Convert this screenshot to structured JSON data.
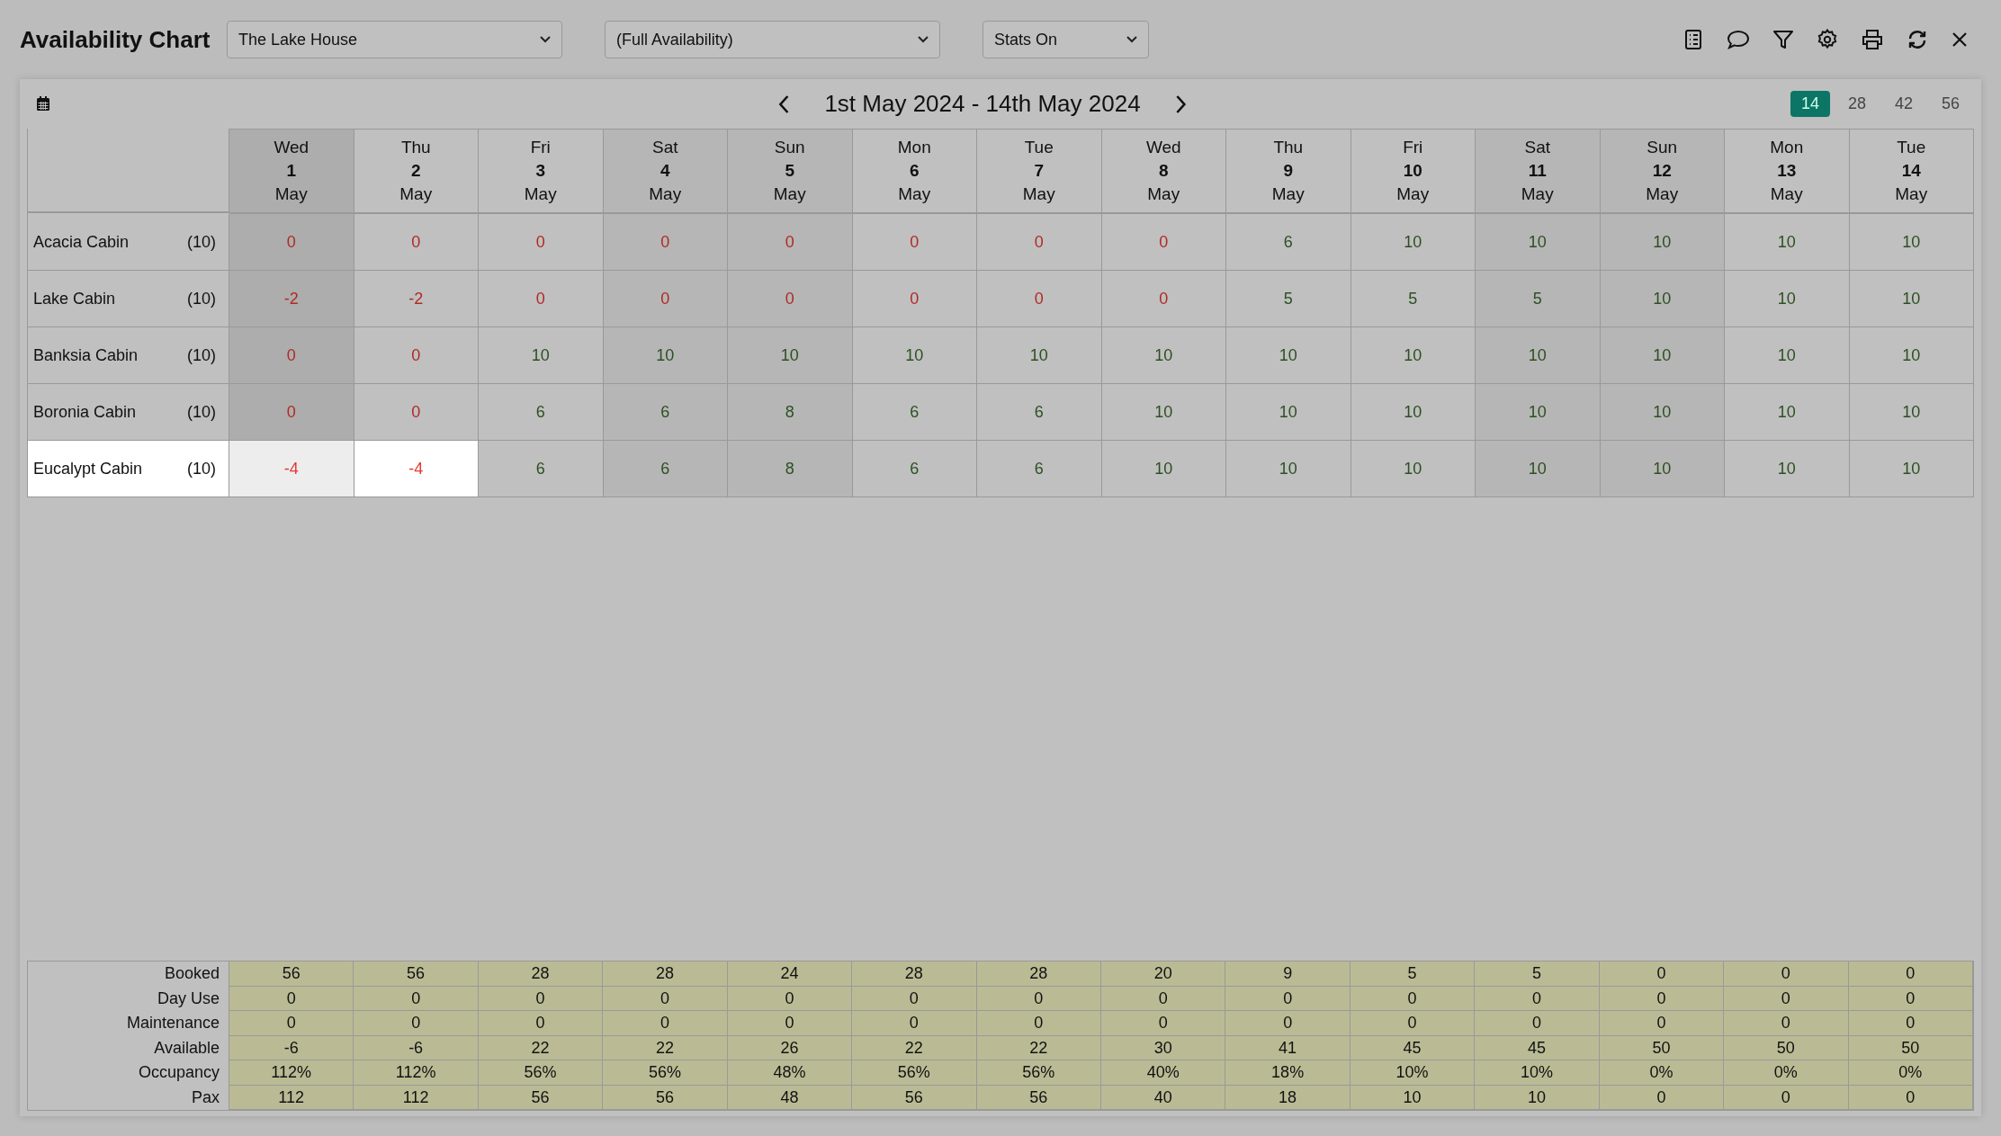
{
  "title": "Availability Chart",
  "property_select": {
    "value": "The Lake House"
  },
  "availability_select": {
    "value": "(Full Availability)"
  },
  "stats_select": {
    "value": "Stats On"
  },
  "date_range": "1st May 2024 - 14th May 2024",
  "range_options": [
    {
      "label": "14",
      "selected": true
    },
    {
      "label": "28",
      "selected": false
    },
    {
      "label": "42",
      "selected": false
    },
    {
      "label": "56",
      "selected": false
    }
  ],
  "days": [
    {
      "weekday": "Wed",
      "day": "1",
      "month": "May",
      "kind": "today"
    },
    {
      "weekday": "Thu",
      "day": "2",
      "month": "May",
      "kind": "weekday"
    },
    {
      "weekday": "Fri",
      "day": "3",
      "month": "May",
      "kind": "weekday"
    },
    {
      "weekday": "Sat",
      "day": "4",
      "month": "May",
      "kind": "weekend"
    },
    {
      "weekday": "Sun",
      "day": "5",
      "month": "May",
      "kind": "weekend"
    },
    {
      "weekday": "Mon",
      "day": "6",
      "month": "May",
      "kind": "weekday"
    },
    {
      "weekday": "Tue",
      "day": "7",
      "month": "May",
      "kind": "weekday"
    },
    {
      "weekday": "Wed",
      "day": "8",
      "month": "May",
      "kind": "weekday"
    },
    {
      "weekday": "Thu",
      "day": "9",
      "month": "May",
      "kind": "weekday"
    },
    {
      "weekday": "Fri",
      "day": "10",
      "month": "May",
      "kind": "weekday"
    },
    {
      "weekday": "Sat",
      "day": "11",
      "month": "May",
      "kind": "weekend"
    },
    {
      "weekday": "Sun",
      "day": "12",
      "month": "May",
      "kind": "weekend"
    },
    {
      "weekday": "Mon",
      "day": "13",
      "month": "May",
      "kind": "weekday"
    },
    {
      "weekday": "Tue",
      "day": "14",
      "month": "May",
      "kind": "weekday"
    }
  ],
  "rooms": [
    {
      "name": "Acacia Cabin",
      "count": "(10)",
      "highlighted": false,
      "cells": [
        {
          "value": "0",
          "full": true,
          "highlighted": false
        },
        {
          "value": "0",
          "full": true,
          "highlighted": false
        },
        {
          "value": "0",
          "full": true,
          "highlighted": false
        },
        {
          "value": "0",
          "full": true,
          "highlighted": false
        },
        {
          "value": "0",
          "full": true,
          "highlighted": false
        },
        {
          "value": "0",
          "full": true,
          "highlighted": false
        },
        {
          "value": "0",
          "full": true,
          "highlighted": false
        },
        {
          "value": "0",
          "full": true,
          "highlighted": false
        },
        {
          "value": "6",
          "full": false,
          "highlighted": false
        },
        {
          "value": "10",
          "full": false,
          "highlighted": false
        },
        {
          "value": "10",
          "full": false,
          "highlighted": false
        },
        {
          "value": "10",
          "full": false,
          "highlighted": false
        },
        {
          "value": "10",
          "full": false,
          "highlighted": false
        },
        {
          "value": "10",
          "full": false,
          "highlighted": false
        }
      ]
    },
    {
      "name": "Lake Cabin",
      "count": "(10)",
      "highlighted": false,
      "cells": [
        {
          "value": "-2",
          "full": true,
          "highlighted": false
        },
        {
          "value": "-2",
          "full": true,
          "highlighted": false
        },
        {
          "value": "0",
          "full": true,
          "highlighted": false
        },
        {
          "value": "0",
          "full": true,
          "highlighted": false
        },
        {
          "value": "0",
          "full": true,
          "highlighted": false
        },
        {
          "value": "0",
          "full": true,
          "highlighted": false
        },
        {
          "value": "0",
          "full": true,
          "highlighted": false
        },
        {
          "value": "0",
          "full": true,
          "highlighted": false
        },
        {
          "value": "5",
          "full": false,
          "highlighted": false
        },
        {
          "value": "5",
          "full": false,
          "highlighted": false
        },
        {
          "value": "5",
          "full": false,
          "highlighted": false
        },
        {
          "value": "10",
          "full": false,
          "highlighted": false
        },
        {
          "value": "10",
          "full": false,
          "highlighted": false
        },
        {
          "value": "10",
          "full": false,
          "highlighted": false
        }
      ]
    },
    {
      "name": "Banksia Cabin",
      "count": "(10)",
      "highlighted": false,
      "cells": [
        {
          "value": "0",
          "full": true,
          "highlighted": false
        },
        {
          "value": "0",
          "full": true,
          "highlighted": false
        },
        {
          "value": "10",
          "full": false,
          "highlighted": false
        },
        {
          "value": "10",
          "full": false,
          "highlighted": false
        },
        {
          "value": "10",
          "full": false,
          "highlighted": false
        },
        {
          "value": "10",
          "full": false,
          "highlighted": false
        },
        {
          "value": "10",
          "full": false,
          "highlighted": false
        },
        {
          "value": "10",
          "full": false,
          "highlighted": false
        },
        {
          "value": "10",
          "full": false,
          "highlighted": false
        },
        {
          "value": "10",
          "full": false,
          "highlighted": false
        },
        {
          "value": "10",
          "full": false,
          "highlighted": false
        },
        {
          "value": "10",
          "full": false,
          "highlighted": false
        },
        {
          "value": "10",
          "full": false,
          "highlighted": false
        },
        {
          "value": "10",
          "full": false,
          "highlighted": false
        }
      ]
    },
    {
      "name": "Boronia Cabin",
      "count": "(10)",
      "highlighted": false,
      "cells": [
        {
          "value": "0",
          "full": true,
          "highlighted": false
        },
        {
          "value": "0",
          "full": true,
          "highlighted": false
        },
        {
          "value": "6",
          "full": false,
          "highlighted": false
        },
        {
          "value": "6",
          "full": false,
          "highlighted": false
        },
        {
          "value": "8",
          "full": false,
          "highlighted": false
        },
        {
          "value": "6",
          "full": false,
          "highlighted": false
        },
        {
          "value": "6",
          "full": false,
          "highlighted": false
        },
        {
          "value": "10",
          "full": false,
          "highlighted": false
        },
        {
          "value": "10",
          "full": false,
          "highlighted": false
        },
        {
          "value": "10",
          "full": false,
          "highlighted": false
        },
        {
          "value": "10",
          "full": false,
          "highlighted": false
        },
        {
          "value": "10",
          "full": false,
          "highlighted": false
        },
        {
          "value": "10",
          "full": false,
          "highlighted": false
        },
        {
          "value": "10",
          "full": false,
          "highlighted": false
        }
      ]
    },
    {
      "name": "Eucalypt Cabin",
      "count": "(10)",
      "highlighted": true,
      "cells": [
        {
          "value": "-4",
          "full": true,
          "highlighted": true
        },
        {
          "value": "-4",
          "full": true,
          "highlighted": true
        },
        {
          "value": "6",
          "full": false,
          "highlighted": false
        },
        {
          "value": "6",
          "full": false,
          "highlighted": false
        },
        {
          "value": "8",
          "full": false,
          "highlighted": false
        },
        {
          "value": "6",
          "full": false,
          "highlighted": false
        },
        {
          "value": "6",
          "full": false,
          "highlighted": false
        },
        {
          "value": "10",
          "full": false,
          "highlighted": false
        },
        {
          "value": "10",
          "full": false,
          "highlighted": false
        },
        {
          "value": "10",
          "full": false,
          "highlighted": false
        },
        {
          "value": "10",
          "full": false,
          "highlighted": false
        },
        {
          "value": "10",
          "full": false,
          "highlighted": false
        },
        {
          "value": "10",
          "full": false,
          "highlighted": false
        },
        {
          "value": "10",
          "full": false,
          "highlighted": false
        }
      ]
    }
  ],
  "stats": [
    {
      "label": "Booked",
      "values": [
        "56",
        "56",
        "28",
        "28",
        "24",
        "28",
        "28",
        "20",
        "9",
        "5",
        "5",
        "0",
        "0",
        "0"
      ]
    },
    {
      "label": "Day Use",
      "values": [
        "0",
        "0",
        "0",
        "0",
        "0",
        "0",
        "0",
        "0",
        "0",
        "0",
        "0",
        "0",
        "0",
        "0"
      ]
    },
    {
      "label": "Maintenance",
      "values": [
        "0",
        "0",
        "0",
        "0",
        "0",
        "0",
        "0",
        "0",
        "0",
        "0",
        "0",
        "0",
        "0",
        "0"
      ]
    },
    {
      "label": "Available",
      "values": [
        "-6",
        "-6",
        "22",
        "22",
        "26",
        "22",
        "22",
        "30",
        "41",
        "45",
        "45",
        "50",
        "50",
        "50"
      ]
    },
    {
      "label": "Occupancy",
      "values": [
        "112%",
        "112%",
        "56%",
        "56%",
        "48%",
        "56%",
        "56%",
        "40%",
        "18%",
        "10%",
        "10%",
        "0%",
        "0%",
        "0%"
      ]
    },
    {
      "label": "Pax",
      "values": [
        "112",
        "112",
        "56",
        "56",
        "48",
        "56",
        "56",
        "40",
        "18",
        "10",
        "10",
        "0",
        "0",
        "0"
      ]
    }
  ]
}
